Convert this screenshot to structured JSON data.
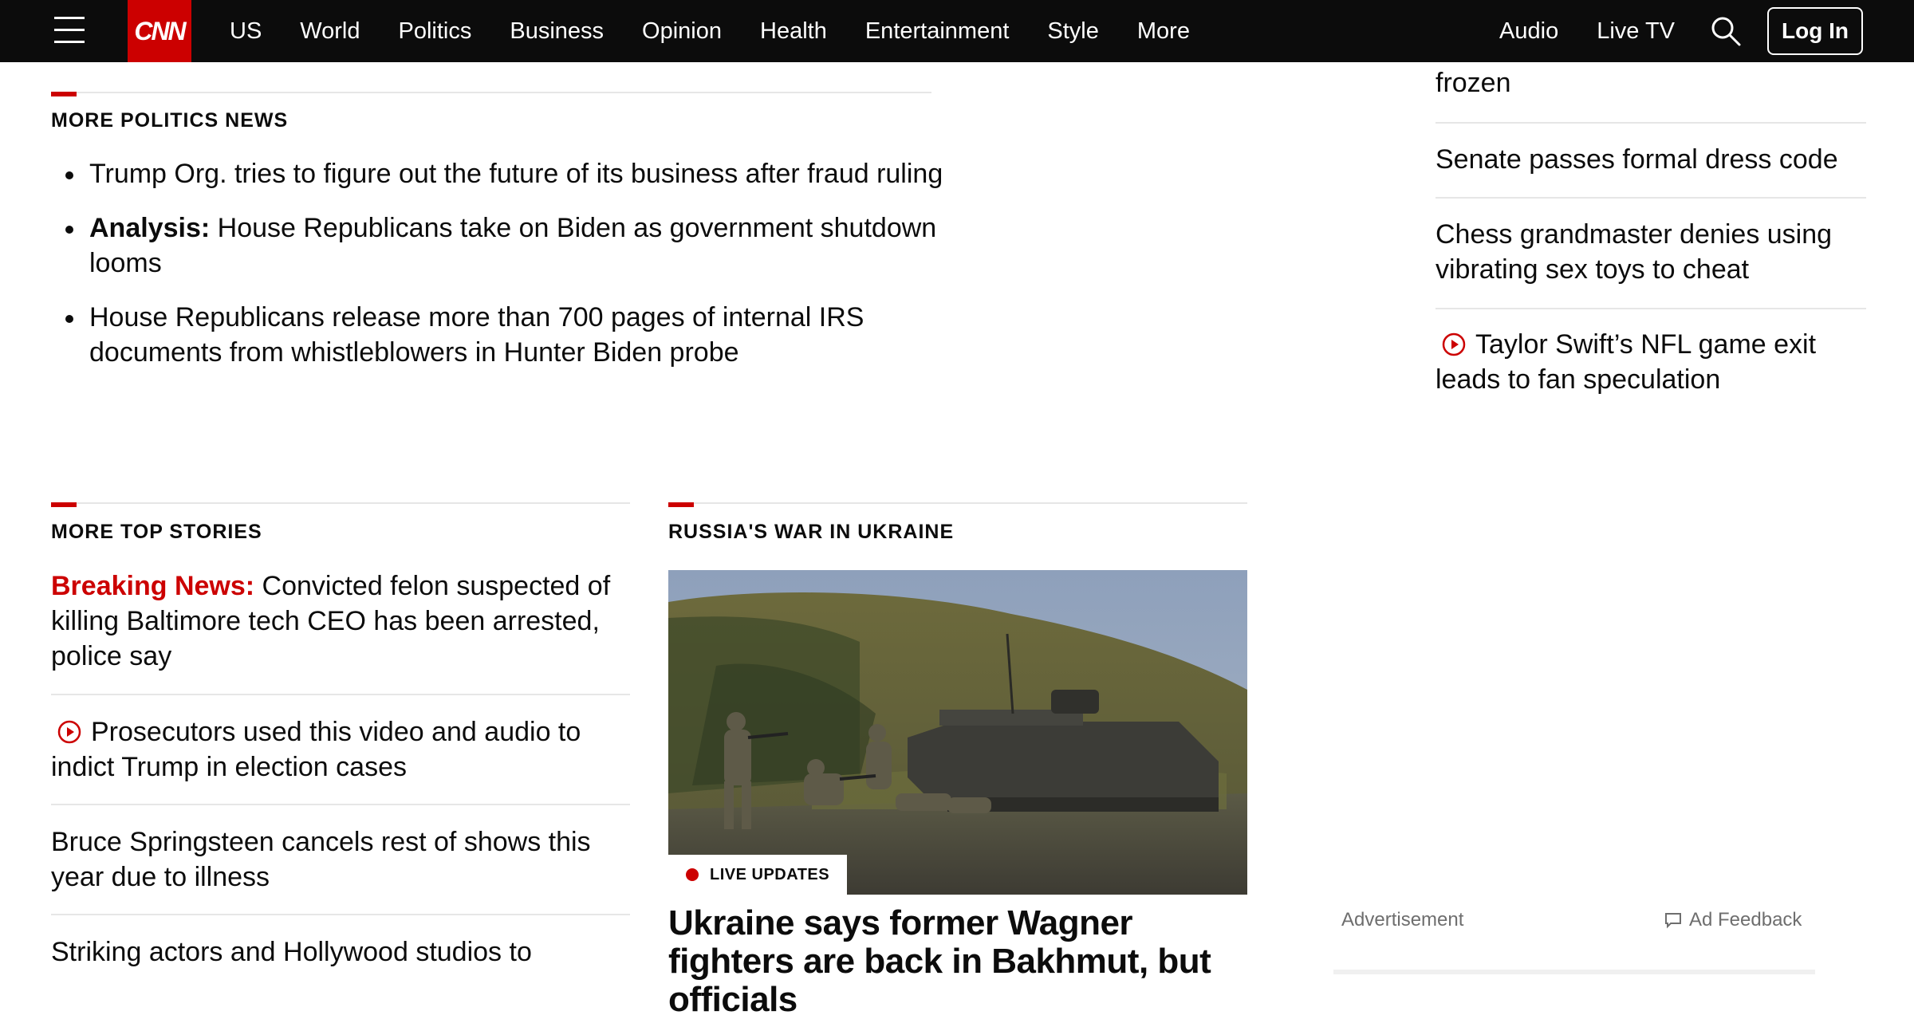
{
  "nav": {
    "logo": "CNN",
    "links": [
      "US",
      "World",
      "Politics",
      "Business",
      "Opinion",
      "Health",
      "Entertainment",
      "Style",
      "More"
    ],
    "right_links": [
      "Audio",
      "Live TV"
    ],
    "login": "Log In",
    "icons": [
      "hamburger-menu-icon",
      "search-icon"
    ]
  },
  "politics": {
    "title": "More Politics News",
    "items": [
      {
        "kicker": "",
        "text": "Trump Org. tries to figure out the future of its business after fraud ruling"
      },
      {
        "kicker": "Analysis:",
        "text": " House Republicans take on Biden as government shutdown looms"
      },
      {
        "kicker": "",
        "text": "House Republicans release more than 700 pages of internal IRS documents from whistleblowers in Hunter Biden probe"
      }
    ]
  },
  "top_stories": {
    "title": "More Top Stories",
    "items": [
      {
        "kicker": "Breaking News:",
        "text": " Convicted felon suspected of killing Baltimore tech CEO has been arrested, police say",
        "video": false
      },
      {
        "kicker": "",
        "text": "Prosecutors used this video and audio to indict Trump in election cases",
        "video": true
      },
      {
        "kicker": "",
        "text": "Bruce Springsteen cancels rest of shows this year due to illness",
        "video": false
      },
      {
        "kicker": "",
        "text": "Striking actors and Hollywood studios to",
        "video": false
      }
    ]
  },
  "ukraine": {
    "title": "Russia's War in Ukraine",
    "badge": "LIVE UPDATES",
    "headline": "Ukraine says former Wagner fighters are back in Bakhmut, but officials",
    "image_desc": "soldiers-with-armored-vehicle"
  },
  "right_column": {
    "items": [
      {
        "text": "frozen",
        "video": false
      },
      {
        "text": "Senate passes formal dress code",
        "video": false
      },
      {
        "text": "Chess grandmaster denies using vibrating sex toys to cheat",
        "video": false
      },
      {
        "text": "Taylor Swift’s NFL game exit leads to fan speculation",
        "video": true
      }
    ]
  },
  "ad": {
    "label": "Advertisement",
    "feedback": "Ad Feedback"
  },
  "colors": {
    "nav_bg": "#0c0c0c",
    "accent": "#cc0000",
    "rule": "#e6e6e6",
    "muted": "#6e6e6e"
  }
}
